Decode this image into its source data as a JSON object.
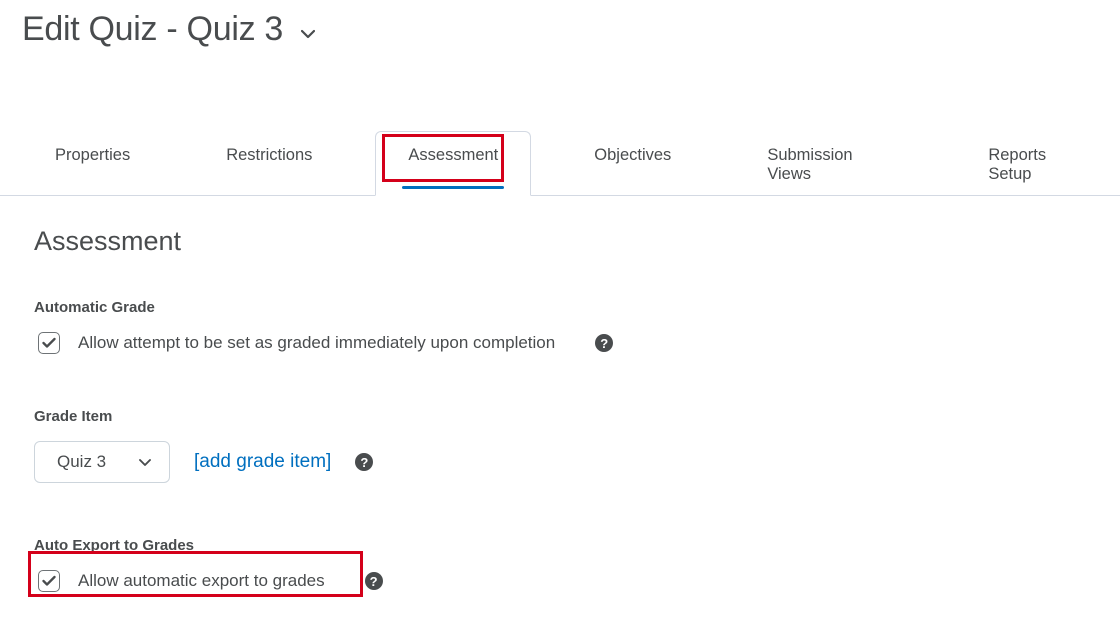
{
  "page": {
    "title": "Edit Quiz - Quiz 3"
  },
  "tabs": {
    "properties": "Properties",
    "restrictions": "Restrictions",
    "assessment": "Assessment",
    "objectives": "Objectives",
    "submission_views": "Submission Views",
    "reports_setup": "Reports Setup"
  },
  "assessment": {
    "heading": "Assessment",
    "automatic_grade": {
      "label": "Automatic Grade",
      "checkbox_label": "Allow attempt to be set as graded immediately upon completion"
    },
    "grade_item": {
      "label": "Grade Item",
      "selected": "Quiz 3",
      "add_link": "[add grade item]"
    },
    "auto_export": {
      "label": "Auto Export to Grades",
      "checkbox_label": "Allow automatic export to grades"
    }
  }
}
